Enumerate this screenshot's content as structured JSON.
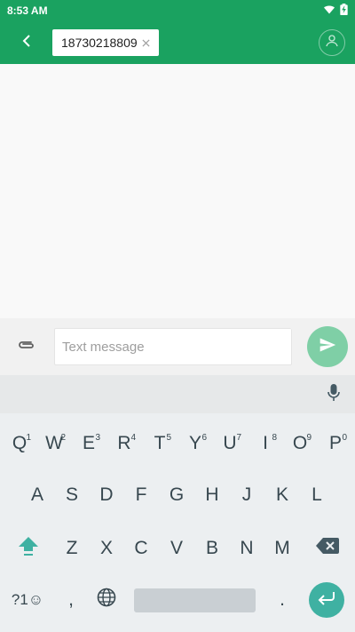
{
  "status_bar": {
    "time": "8:53 AM",
    "icons": [
      "wifi-icon",
      "battery-charging-icon"
    ]
  },
  "app_bar": {
    "back_icon": "arrow-back-icon",
    "recipient": "18730218809",
    "chip_close_icon": "close-icon",
    "contact_icon": "person-icon"
  },
  "compose": {
    "attach_icon": "paperclip-icon",
    "placeholder": "Text message",
    "value": "",
    "send_icon": "send-icon"
  },
  "suggestions": {
    "mic_icon": "microphone-icon"
  },
  "keyboard": {
    "row1": [
      {
        "label": "Q",
        "hint": "1"
      },
      {
        "label": "W",
        "hint": "2"
      },
      {
        "label": "E",
        "hint": "3"
      },
      {
        "label": "R",
        "hint": "4"
      },
      {
        "label": "T",
        "hint": "5"
      },
      {
        "label": "Y",
        "hint": "6"
      },
      {
        "label": "U",
        "hint": "7"
      },
      {
        "label": "I",
        "hint": "8"
      },
      {
        "label": "O",
        "hint": "9"
      },
      {
        "label": "P",
        "hint": "0"
      }
    ],
    "row2": [
      "A",
      "S",
      "D",
      "F",
      "G",
      "H",
      "J",
      "K",
      "L"
    ],
    "row3": [
      "Z",
      "X",
      "C",
      "V",
      "B",
      "N",
      "M"
    ],
    "symbols_label": "?1☺",
    "comma_label": ",",
    "period_label": ".",
    "shift_icon": "shift-icon",
    "backspace_icon": "backspace-icon",
    "globe_icon": "globe-icon",
    "enter_icon": "enter-icon"
  },
  "colors": {
    "brand": "#1aa260",
    "send_button": "#7fcfa6",
    "keyboard_accent": "#3fb1a2",
    "keyboard_bg": "#eceff1"
  }
}
